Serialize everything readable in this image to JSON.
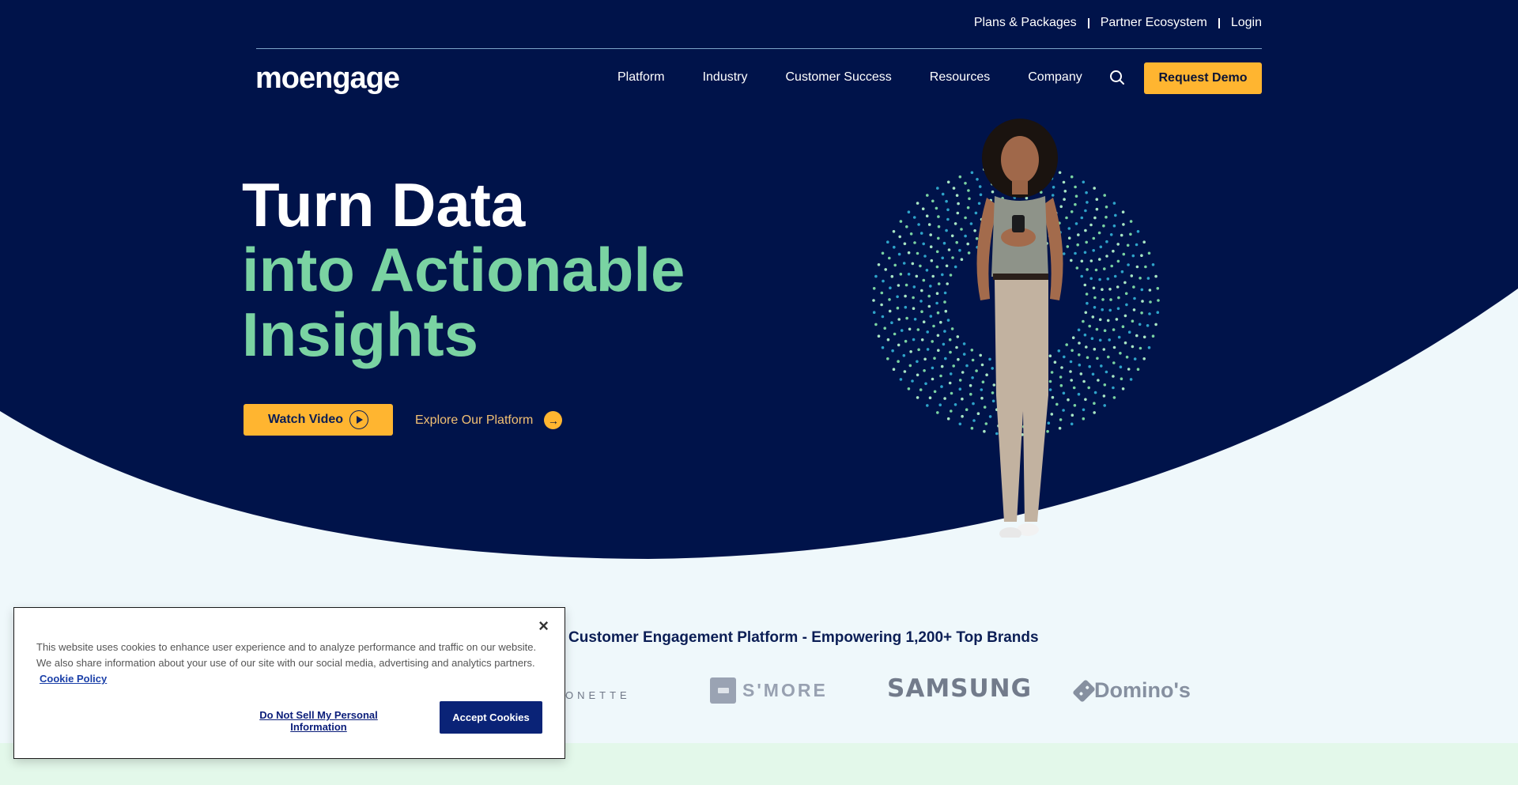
{
  "colors": {
    "navy": "#00134a",
    "accent_yellow": "#ffb530",
    "accent_green": "#7ad3a2",
    "light_bg": "#eff8fb",
    "cookie_button": "#0a2377"
  },
  "utility_nav": {
    "items": [
      {
        "label": "Plans & Packages"
      },
      {
        "label": "Partner Ecosystem"
      },
      {
        "label": "Login"
      }
    ]
  },
  "header": {
    "logo": "moengage",
    "nav": [
      {
        "label": "Platform"
      },
      {
        "label": "Industry"
      },
      {
        "label": "Customer Success"
      },
      {
        "label": "Resources"
      },
      {
        "label": "Company"
      }
    ],
    "search_icon": "search-icon",
    "cta_label": "Request Demo"
  },
  "hero": {
    "title_line1": "Turn Data",
    "title_line2": "into Actionable",
    "title_line3": "Insights",
    "watch_video_label": "Watch Video",
    "explore_label": "Explore Our Platform",
    "explore_icon": "→"
  },
  "brands": {
    "heading": "Customer Engagement Platform - Empowering 1,200+ Top Brands",
    "logos": [
      {
        "name": "ONETTE"
      },
      {
        "name": "S'MORE"
      },
      {
        "name": "SAMSUNG"
      },
      {
        "name": "Domino's"
      }
    ]
  },
  "cookie_banner": {
    "close_label": "×",
    "text": "This website uses cookies to enhance user experience and to analyze performance and traffic on our website. We also share information about your use of our site with our social media, advertising and analytics partners.",
    "policy_link": "Cookie Policy",
    "do_not_sell_label": "Do Not Sell My Personal Information",
    "accept_label": "Accept Cookies"
  }
}
